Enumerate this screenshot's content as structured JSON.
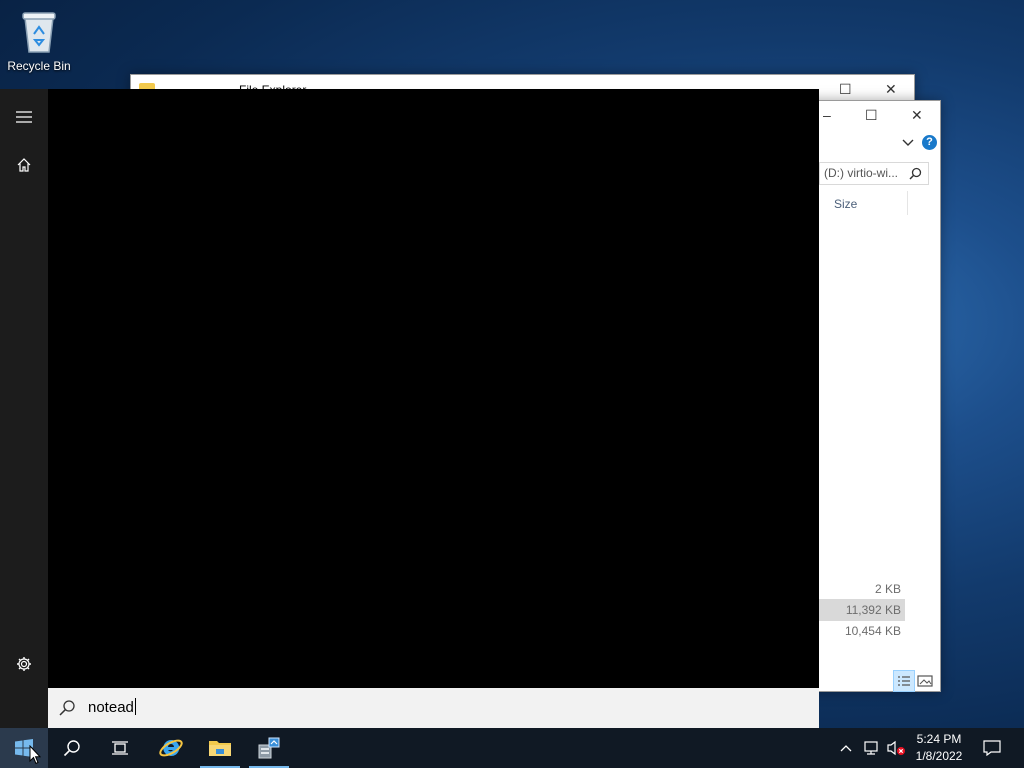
{
  "desktop": {
    "recycle_bin_label": "Recycle Bin"
  },
  "back_window": {
    "title": "File Explorer",
    "controls": {
      "maximize": "☐",
      "close": "✕"
    }
  },
  "front_window": {
    "controls": {
      "minimize": "–",
      "maximize": "☐",
      "close": "✕"
    },
    "help": "?",
    "address": "(D:) virtio-wi...",
    "column_size": "Size",
    "sizes": [
      "2 KB",
      "11,392 KB",
      "10,454 KB"
    ]
  },
  "search": {
    "query": "notead"
  },
  "clock": {
    "time": "5:24 PM",
    "date": "1/8/2022"
  },
  "colors": {
    "accent": "#76b9ed",
    "taskbar": "#101924",
    "start_menu": "#000000"
  }
}
